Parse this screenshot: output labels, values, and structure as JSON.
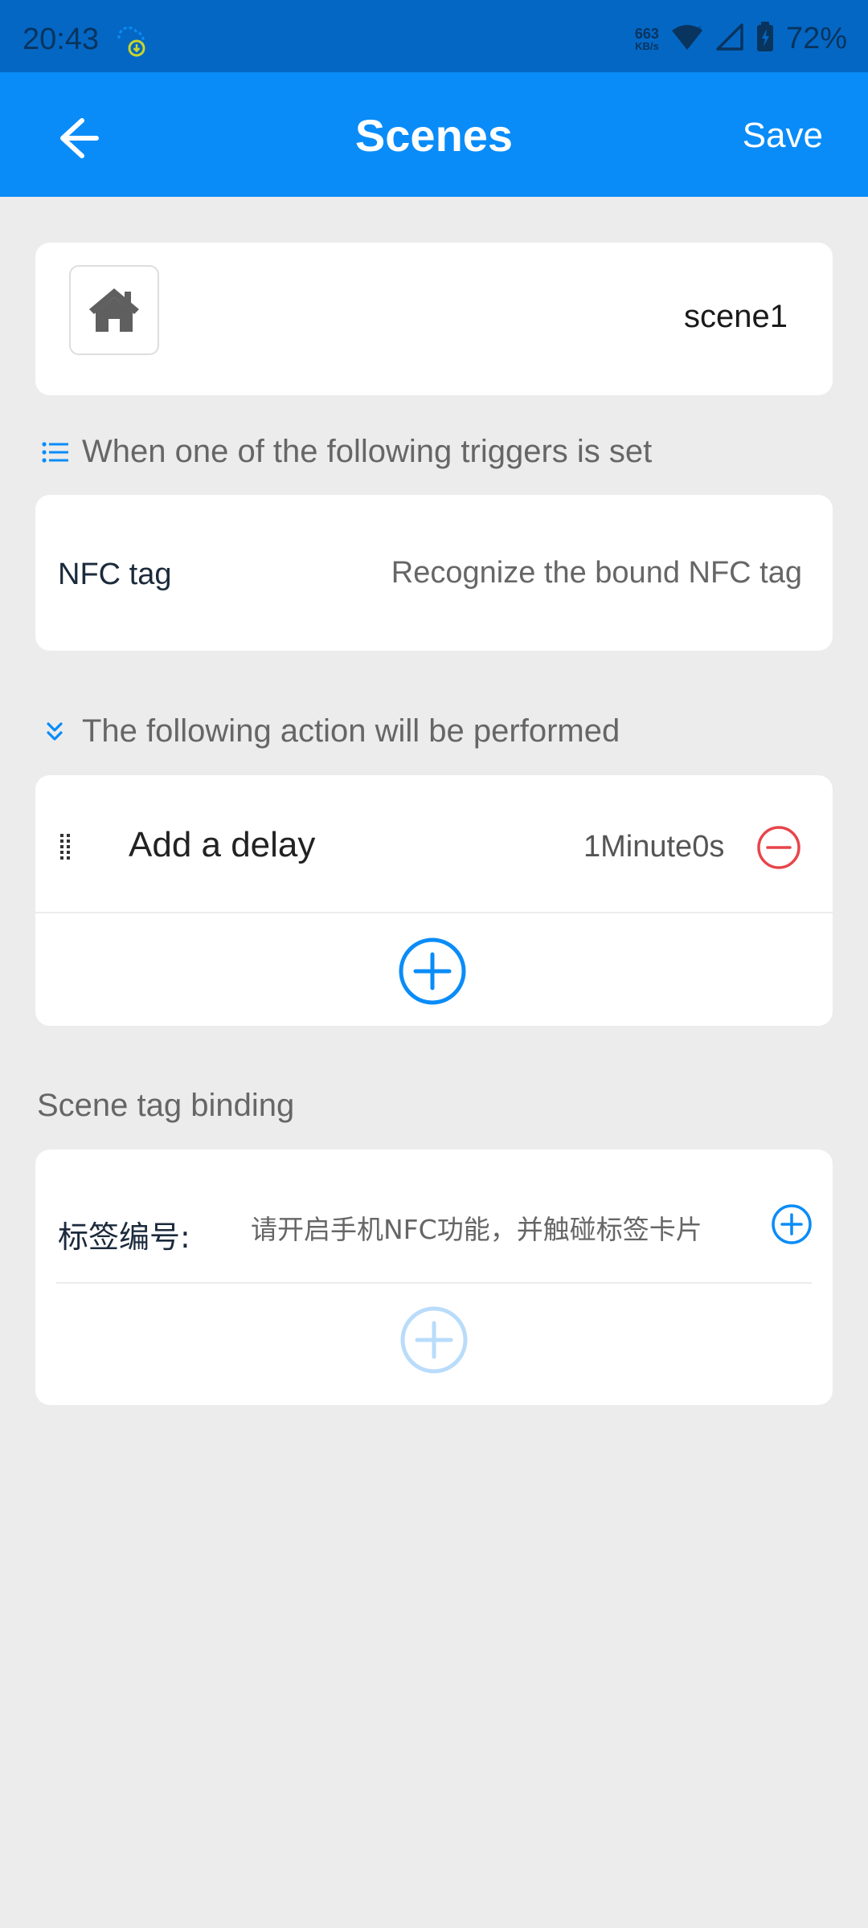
{
  "status_bar": {
    "time": "20:43",
    "net_speed_value": "663",
    "net_speed_unit": "KB/s",
    "battery_percent": "72%"
  },
  "app_bar": {
    "title": "Scenes",
    "save_label": "Save",
    "accent_color": "#0a8cf8"
  },
  "scene": {
    "icon": "home-icon",
    "name": "scene1"
  },
  "triggers_section": {
    "label": "When one of the following triggers is set",
    "items": [
      {
        "name": "NFC tag",
        "description": "Recognize the bound NFC tag"
      }
    ]
  },
  "actions_section": {
    "label": "The following action will be performed",
    "items": [
      {
        "name": "Add a delay",
        "value": "1Minute0s"
      }
    ]
  },
  "binding_section": {
    "label": "Scene tag binding",
    "tag_label": "标签编号:",
    "tag_placeholder": "请开启手机NFC功能，并触碰标签卡片"
  },
  "colors": {
    "remove": "#e8444a",
    "add": "#0a8cf8",
    "add_disabled": "#b9dcfb"
  }
}
